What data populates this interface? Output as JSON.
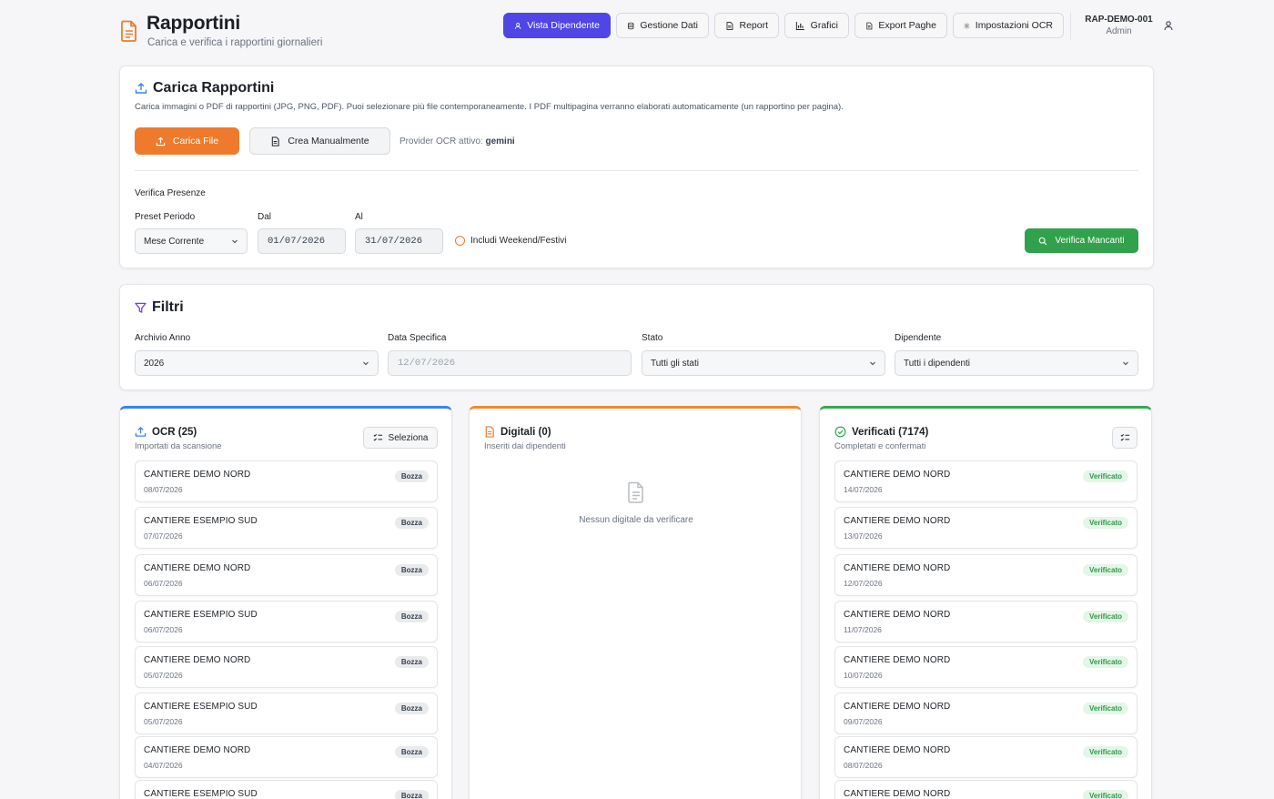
{
  "header": {
    "title": "Rapportini",
    "subtitle": "Carica e verifica i rapportini giornalieri",
    "nav": [
      {
        "label": "Vista Dipendente",
        "icon": "user-icon"
      },
      {
        "label": "Gestione Dati",
        "icon": "database-icon"
      },
      {
        "label": "Report",
        "icon": "document-icon"
      },
      {
        "label": "Grafici",
        "icon": "bar-chart-icon"
      },
      {
        "label": "Export Paghe",
        "icon": "document-icon"
      },
      {
        "label": "Impostazioni OCR",
        "icon": "gear-icon"
      }
    ],
    "user_id": "RAP-DEMO-001",
    "user_role": "Admin"
  },
  "upload": {
    "title": "Carica Rapportini",
    "description": "Carica immagini o PDF di rapportini (JPG, PNG, PDF). Puoi selezionare più file contemporaneamente. I PDF multipagina verranno elaborati automaticamente (un rapportino per pagina).",
    "upload_label": "Carica File",
    "manual_label": "Crea Manualmente",
    "provider_prefix": "Provider OCR attivo:",
    "provider_value": "gemini",
    "check_title": "Verifica Presenze",
    "preset_label": "Preset Periodo",
    "preset_value": "Mese Corrente",
    "from_label": "Dal",
    "from_value": "01/07/2026",
    "to_label": "Al",
    "to_value": "31/07/2026",
    "weekend_label": "Includi Weekend/Festivi",
    "verify_label": "Verifica Mancanti"
  },
  "filters": {
    "title": "Filtri",
    "year_label": "Archivio Anno",
    "year_value": "2026",
    "date_label": "Data Specifica",
    "date_placeholder": "12/07/2026",
    "status_label": "Stato",
    "status_value": "Tutti gli stati",
    "employee_label": "Dipendente",
    "employee_value": "Tutti i dipendenti"
  },
  "columns": {
    "ocr": {
      "title": "OCR (25)",
      "subtitle": "Importati da scansione",
      "select_label": "Seleziona",
      "badge": "Bozza",
      "items": [
        {
          "name": "CANTIERE DEMO NORD",
          "date": "08/07/2026"
        },
        {
          "name": "CANTIERE ESEMPIO SUD",
          "date": "07/07/2026"
        },
        {
          "name": "CANTIERE DEMO NORD",
          "date": "06/07/2026"
        },
        {
          "name": "CANTIERE ESEMPIO SUD",
          "date": "06/07/2026"
        },
        {
          "name": "CANTIERE DEMO NORD",
          "date": "05/07/2026"
        },
        {
          "name": "CANTIERE ESEMPIO SUD",
          "date": "05/07/2026"
        },
        {
          "name": "CANTIERE DEMO NORD",
          "date": "04/07/2026"
        },
        {
          "name": "CANTIERE ESEMPIO SUD",
          "date": ""
        }
      ]
    },
    "digital": {
      "title": "Digitali (0)",
      "subtitle": "Inseriti dai dipendenti",
      "empty_text": "Nessun digitale da verificare"
    },
    "verified": {
      "title": "Verificati (7174)",
      "subtitle": "Completati e confermati",
      "badge": "Verificato",
      "items": [
        {
          "name": "CANTIERE DEMO NORD",
          "date": "14/07/2026"
        },
        {
          "name": "CANTIERE DEMO NORD",
          "date": "13/07/2026"
        },
        {
          "name": "CANTIERE DEMO NORD",
          "date": "12/07/2026"
        },
        {
          "name": "CANTIERE DEMO NORD",
          "date": "11/07/2026"
        },
        {
          "name": "CANTIERE DEMO NORD",
          "date": "10/07/2026"
        },
        {
          "name": "CANTIERE DEMO NORD",
          "date": "09/07/2026"
        },
        {
          "name": "CANTIERE DEMO NORD",
          "date": "08/07/2026"
        },
        {
          "name": "CANTIERE DEMO NORD",
          "date": ""
        }
      ]
    }
  },
  "colors": {
    "accent": "#4f46e5",
    "orange": "#ef7a2c",
    "green": "#31a14c",
    "blue": "#3b82f6"
  }
}
